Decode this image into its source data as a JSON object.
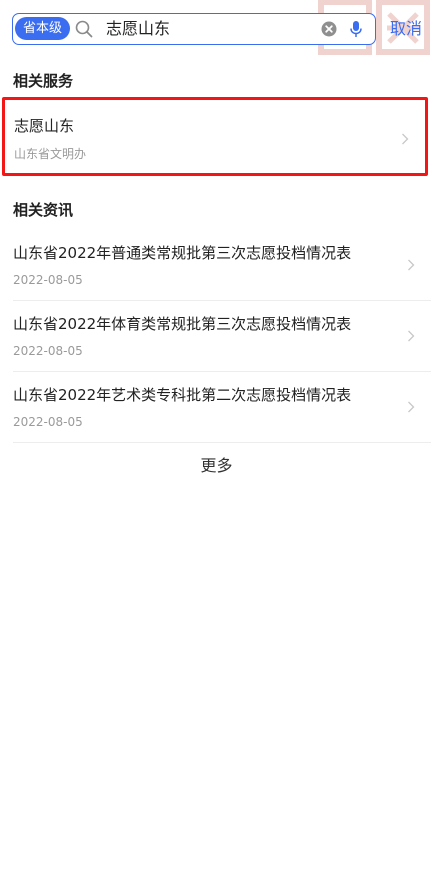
{
  "search": {
    "scope_label": "省本级",
    "query": "志愿山东",
    "cancel_label": "取消"
  },
  "services": {
    "section_title": "相关服务",
    "items": [
      {
        "name": "志愿山东",
        "department": "山东省文明办"
      }
    ]
  },
  "news": {
    "section_title": "相关资讯",
    "items": [
      {
        "title": "山东省2022年普通类常规批第三次志愿投档情况表",
        "date": "2022-08-05"
      },
      {
        "title": "山东省2022年体育类常规批第三次志愿投档情况表",
        "date": "2022-08-05"
      },
      {
        "title": "山东省2022年艺术类专科批第二次志愿投档情况表",
        "date": "2022-08-05"
      }
    ],
    "more_label": "更多"
  },
  "colors": {
    "accent": "#3a6df0",
    "highlight_border": "#f21616",
    "seal": "#c0392b"
  },
  "icons": [
    "search-icon",
    "clear-icon",
    "microphone-icon",
    "chevron-right-icon",
    "seal-emblem"
  ]
}
